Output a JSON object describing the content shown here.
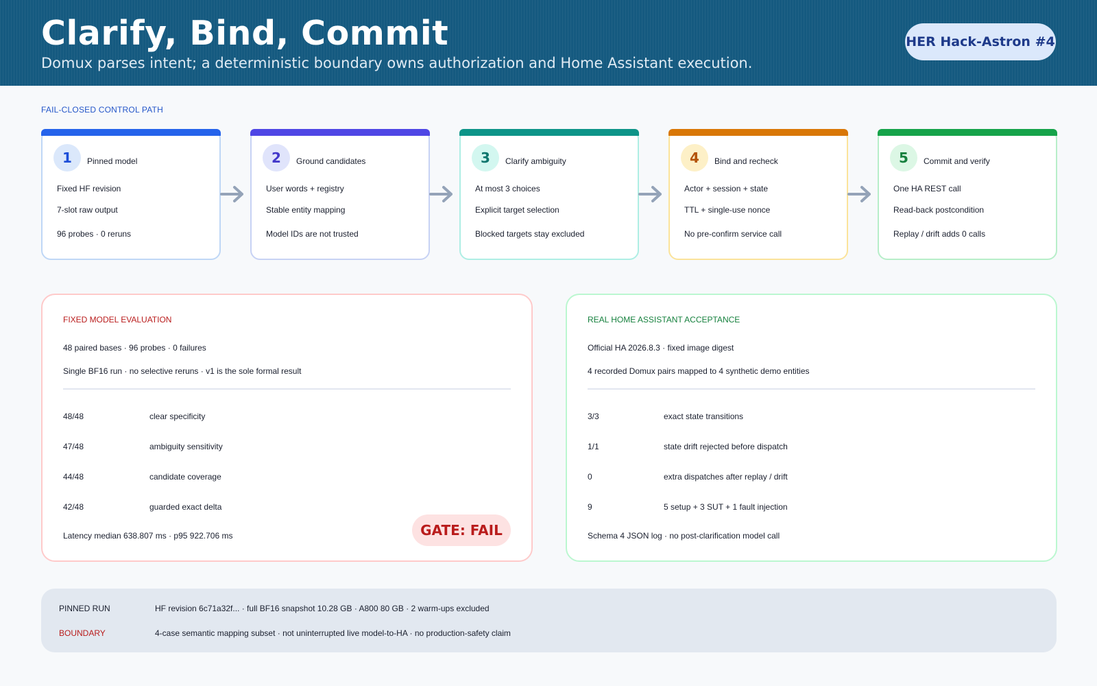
{
  "header": {
    "title": "Clarify, Bind, Commit",
    "subtitle": "Domux parses intent; a deterministic boundary owns authorization and Home Assistant execution.",
    "badge": "HER Hack-Astron #4"
  },
  "control_path": {
    "label": "FAIL-CLOSED CONTROL PATH",
    "steps": [
      {
        "number": "1",
        "title": "Pinned model",
        "lines": [
          "Fixed HF revision",
          "7-slot raw output",
          "96 probes · 0 reruns"
        ],
        "accent": "#2563eb",
        "border": "#bfd7f6",
        "num_bg": "#dbe8fb",
        "num_color": "#1d4ed8"
      },
      {
        "number": "2",
        "title": "Ground candidates",
        "lines": [
          "User words + registry",
          "Stable entity mapping",
          "Model IDs are not trusted"
        ],
        "accent": "#4f46e5",
        "border": "#c7d2f4",
        "num_bg": "#e0e4fb",
        "num_color": "#4338ca"
      },
      {
        "number": "3",
        "title": "Clarify ambiguity",
        "lines": [
          "At most 3 choices",
          "Explicit target selection",
          "Blocked targets stay excluded"
        ],
        "accent": "#0d9488",
        "border": "#aeeee4",
        "num_bg": "#d3f7f0",
        "num_color": "#0f766e"
      },
      {
        "number": "4",
        "title": "Bind and recheck",
        "lines": [
          "Actor + session + state",
          "TTL + single-use nonce",
          "No pre-confirm service call"
        ],
        "accent": "#d97706",
        "border": "#fbe39a",
        "num_bg": "#fdf0c7",
        "num_color": "#b45309"
      },
      {
        "number": "5",
        "title": "Commit and verify",
        "lines": [
          "One HA REST call",
          "Read-back postcondition",
          "Replay / drift adds 0 calls"
        ],
        "accent": "#16a34a",
        "border": "#b7eec9",
        "num_bg": "#dcf7e5",
        "num_color": "#15803d"
      }
    ],
    "arrow_color": "#94a3b8"
  },
  "evaluation": {
    "label": "FIXED MODEL EVALUATION",
    "label_color": "#b91c1c",
    "border": "#fecaca",
    "summary": [
      "48 paired bases · 96 probes · 0 failures",
      "Single BF16 run · no selective reruns · v1 is the sole formal result"
    ],
    "metrics": [
      {
        "value": "48/48",
        "desc": "clear specificity"
      },
      {
        "value": "47/48",
        "desc": "ambiguity sensitivity"
      },
      {
        "value": "44/48",
        "desc": "candidate coverage"
      },
      {
        "value": "42/48",
        "desc": "guarded exact delta"
      }
    ],
    "latency": "Latency median 638.807 ms · p95 922.706 ms",
    "gate": "GATE: FAIL"
  },
  "acceptance": {
    "label": "REAL HOME ASSISTANT ACCEPTANCE",
    "label_color": "#15803d",
    "border": "#bbf7d0",
    "summary": [
      "Official HA 2026.8.3 · fixed image digest",
      "4 recorded Domux pairs mapped to 4 synthetic demo entities"
    ],
    "metrics": [
      {
        "value": "3/3",
        "desc": "exact state transitions"
      },
      {
        "value": "1/1",
        "desc": "state drift rejected before dispatch"
      },
      {
        "value": "0",
        "desc": "extra dispatches after replay / drift"
      },
      {
        "value": "9",
        "desc": "5 setup + 3 SUT + 1 fault injection"
      }
    ],
    "log_note": "Schema 4 JSON log · no post-clarification model call"
  },
  "footer": {
    "pinned_label": "PINNED RUN",
    "pinned_text": "HF revision 6c71a32f... · full BF16 snapshot 10.28 GB · A800 80 GB · 2 warm-ups excluded",
    "boundary_label": "BOUNDARY",
    "boundary_text": "4-case semantic mapping subset · not uninterrupted live model-to-HA · no production-safety claim",
    "boundary_color": "#b91c1c"
  }
}
